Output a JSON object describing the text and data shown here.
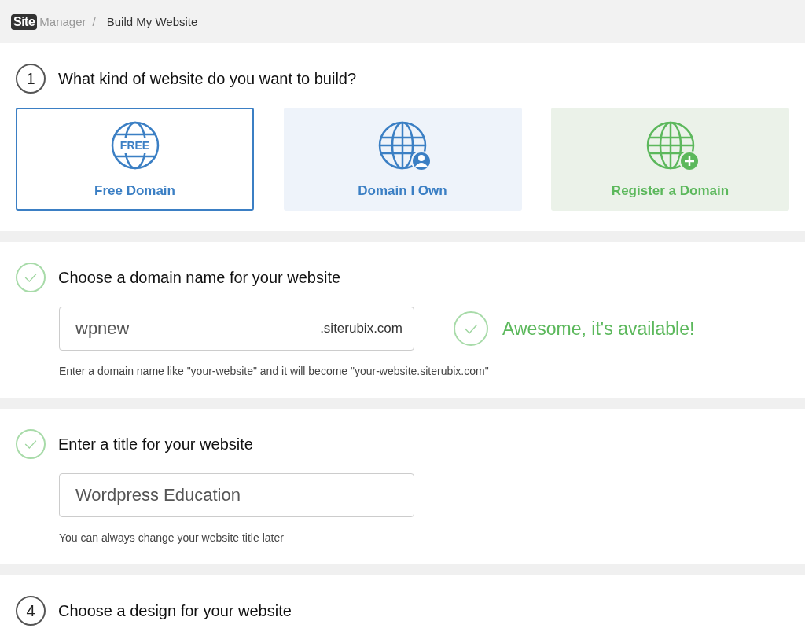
{
  "breadcrumb": {
    "logo_badge": "Site",
    "logo_text": "Manager",
    "separator": "/",
    "current": "Build My Website"
  },
  "steps": [
    {
      "kind": "number",
      "marker": "1",
      "title": "What kind of website do you want to build?",
      "options": [
        {
          "kind": "free",
          "label": "Free Domain",
          "icon_text": "FREE",
          "selected": true
        },
        {
          "kind": "own",
          "label": "Domain I Own",
          "selected": false
        },
        {
          "kind": "register",
          "label": "Register a Domain",
          "selected": false
        }
      ]
    },
    {
      "kind": "done",
      "title": "Choose a domain name for your website",
      "field": {
        "value": "wpnew",
        "suffix": ".siterubix.com"
      },
      "status": "Awesome, it's available!",
      "hint": "Enter a domain name like \"your-website\" and it will become \"your-website.siterubix.com\""
    },
    {
      "kind": "done",
      "title": "Enter a title for your website",
      "field": {
        "value": "Wordpress Education"
      },
      "hint": "You can always change your website title later"
    },
    {
      "kind": "number",
      "marker": "4",
      "title": "Choose a design for your website"
    }
  ]
}
